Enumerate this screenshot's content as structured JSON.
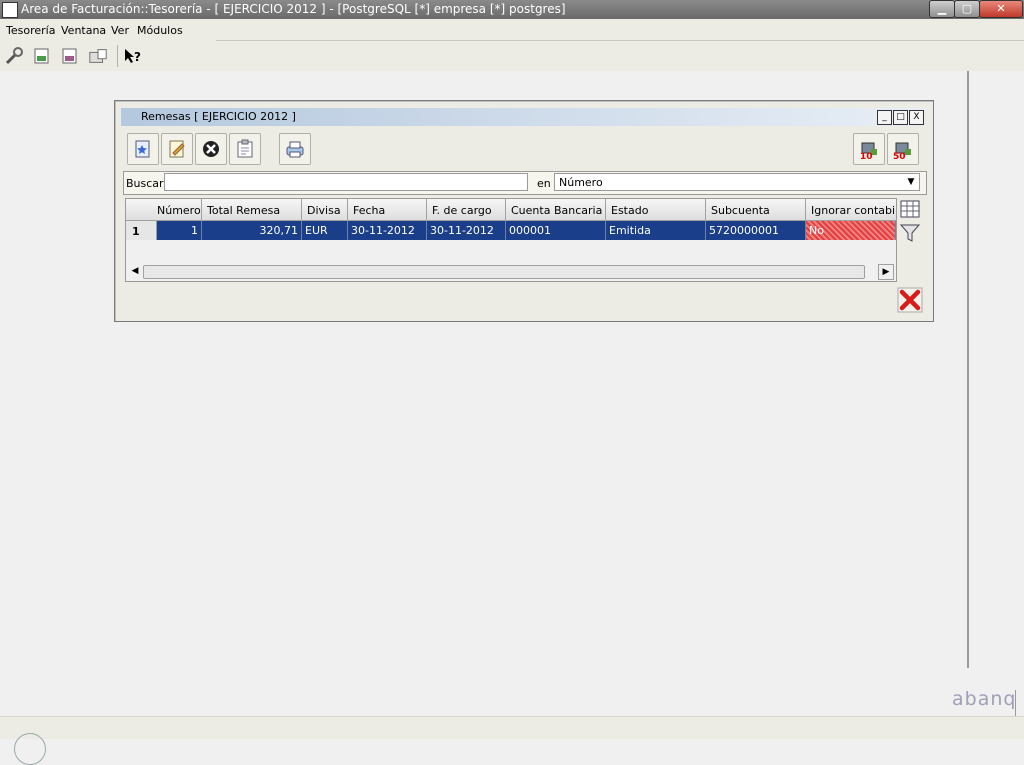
{
  "window": {
    "title": "Area de Facturación::Tesorería  - [ EJERCICIO 2012 ] - [PostgreSQL [*] empresa [*] postgres]",
    "min_label": "▁",
    "max_label": "▢",
    "close_label": "✕"
  },
  "menu": {
    "items": [
      "Tesorería",
      "Ventana",
      "Ver",
      "Módulos"
    ]
  },
  "child": {
    "title": "Remesas [ EJERCICIO 2012 ]",
    "btn_min": "_",
    "btn_max": "□",
    "btn_close": "X",
    "badge1": "10",
    "badge2": "50"
  },
  "search": {
    "label": "Buscar",
    "value": "",
    "en_label": "en",
    "field": "Número"
  },
  "table": {
    "columns": [
      "Número",
      "Total Remesa",
      "Divisa",
      "Fecha",
      "F. de cargo",
      "Cuenta Bancaria",
      "Estado",
      "Subcuenta",
      "Ignorar contabilid"
    ],
    "rows": [
      {
        "index": "1",
        "cells": [
          "1",
          "320,71",
          "EUR",
          "30-11-2012",
          "30-11-2012",
          "000001",
          "Emitida",
          "5720000001",
          "No"
        ]
      }
    ]
  },
  "branding": {
    "logo": "abanq"
  }
}
